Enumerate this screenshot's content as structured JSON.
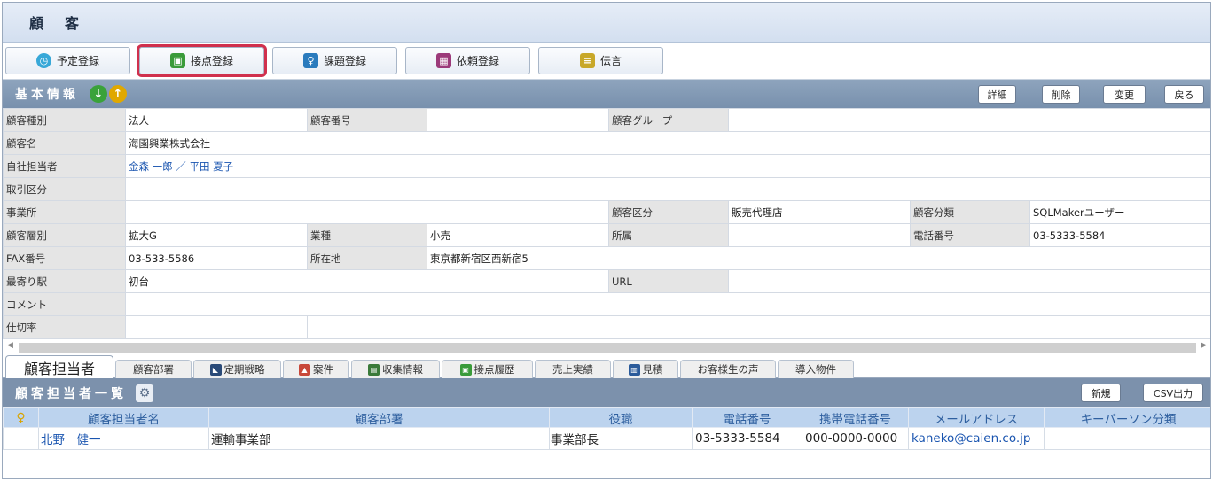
{
  "window": {
    "title": "顧　客"
  },
  "toolbar": {
    "buttons": [
      {
        "label": "予定登録",
        "icon": "clock-icon",
        "color": "#38a8d8"
      },
      {
        "label": "接点登録",
        "icon": "contact-icon",
        "color": "#3a9b3a",
        "active": true
      },
      {
        "label": "課題登録",
        "icon": "key-icon",
        "color": "#2a7bbd"
      },
      {
        "label": "依頼登録",
        "icon": "gift-icon",
        "color": "#9c3a7a"
      },
      {
        "label": "伝言",
        "icon": "memo-icon",
        "color": "#78a82a"
      }
    ]
  },
  "basic": {
    "title": "基本情報",
    "down_arrow": "↓",
    "up_arrow": "↑",
    "buttons": {
      "detail": "詳細",
      "delete": "削除",
      "change": "変更",
      "back": "戻る"
    },
    "rows": [
      [
        "顧客種別",
        "法人",
        "顧客番号",
        "",
        "顧客グループ",
        ""
      ],
      [
        "顧客名",
        "海園興業株式会社"
      ],
      [
        "自社担当者",
        "金森 一郎 ／ 平田 夏子"
      ],
      [
        "取引区分",
        ""
      ],
      [
        "事業所",
        "",
        "顧客区分",
        "販売代理店",
        "顧客分類",
        "SQLMakerユーザー"
      ],
      [
        "顧客層別",
        "拡大G",
        "業種",
        "小売",
        "所属",
        "",
        "電話番号",
        "03-5333-5584"
      ],
      [
        "FAX番号",
        "03-533-5586",
        "所在地",
        "東京都新宿区西新宿5"
      ],
      [
        "最寄り駅",
        "初台",
        "URL",
        ""
      ],
      [
        "コメント",
        ""
      ],
      [
        "仕切率",
        ""
      ]
    ]
  },
  "tabs": [
    {
      "label": "顧客担当者",
      "active": true
    },
    {
      "label": "顧客部署"
    },
    {
      "label": "定期戦略",
      "icon": "strategy-icon",
      "color": "#2a4a78"
    },
    {
      "label": "案件",
      "icon": "deal-icon",
      "color": "#c8483a"
    },
    {
      "label": "収集情報",
      "icon": "info-icon",
      "color": "#3a7a3a"
    },
    {
      "label": "接点履歴",
      "icon": "history-icon",
      "color": "#3a9b3a"
    },
    {
      "label": "売上実績"
    },
    {
      "label": "見積",
      "icon": "estimate-icon",
      "color": "#2a5a9a"
    },
    {
      "label": "お客様生の声"
    },
    {
      "label": "導入物件"
    }
  ],
  "contacts": {
    "title": "顧客担当者一覧",
    "buttons": {
      "new": "新規",
      "csv": "CSV出力"
    },
    "columns": [
      "顧客担当者名",
      "顧客部署",
      "役職",
      "電話番号",
      "携帯電話番号",
      "メールアドレス",
      "キーパーソン分類"
    ],
    "rows": [
      {
        "name": "北野　健一",
        "dept": "運輸事業部",
        "title": "事業部長",
        "tel": "03-5333-5584",
        "mobile": "000-0000-0000",
        "email": "kaneko@caien.co.jp",
        "kp": ""
      }
    ]
  }
}
